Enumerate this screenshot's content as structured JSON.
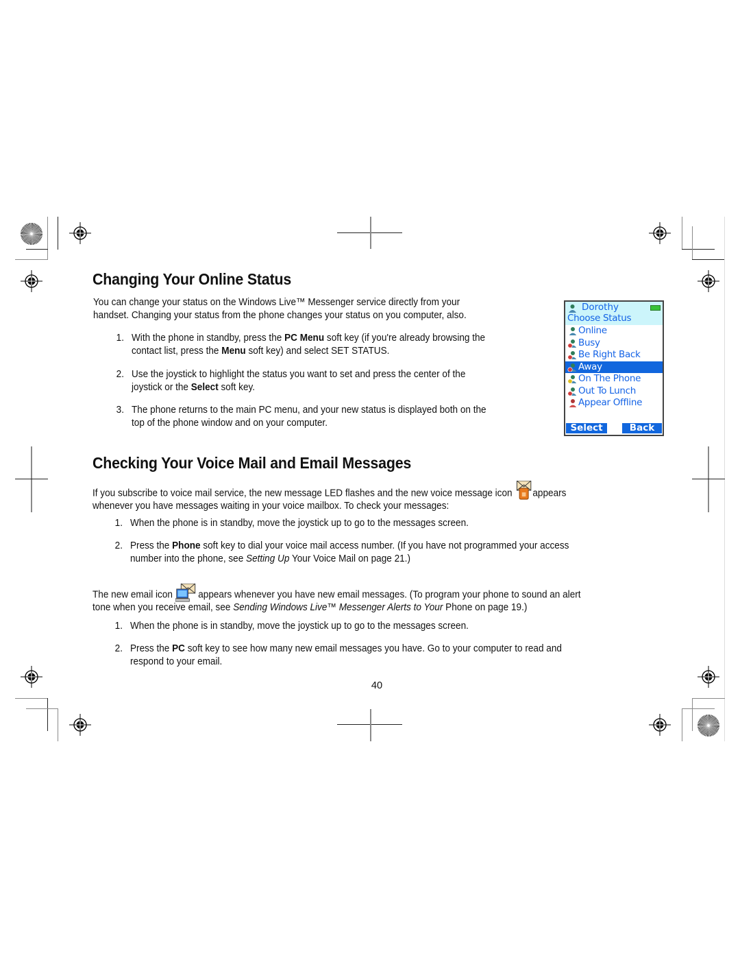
{
  "page_number": "40",
  "section1": {
    "heading": "Changing Your Online Status",
    "intro_line1": "You can change your status on the Windows Live™ Messenger service directly from your",
    "intro_line2": "handset. Changing your status from the phone changes your status on you computer, also.",
    "steps": [
      {
        "num": "1.",
        "line1_pre": "With the phone in standby, press the ",
        "line1_bold": "PC Menu",
        "line1_post": " soft key (if you're already browsing the",
        "line2_pre": "contact list, press the ",
        "line2_bold": "Menu",
        "line2_post": " soft key) and select SET STATUS."
      },
      {
        "num": "2.",
        "line1": "Use the joystick to highlight the status you want to set and press the center of the",
        "line2_pre": "joystick or the ",
        "line2_bold": "Select",
        "line2_post": " soft key."
      },
      {
        "num": "3.",
        "line1": "The phone returns to the main PC menu, and your new status is displayed both on the",
        "line2": "top of the phone window and on your computer."
      }
    ]
  },
  "phone_screen": {
    "user_name": "Dorothy",
    "title": "Choose Status",
    "battery_icon": "battery-full-icon",
    "statuses": [
      {
        "label": "Online",
        "icon": "user-online-icon",
        "selected": false
      },
      {
        "label": "Busy",
        "icon": "user-busy-icon",
        "selected": false
      },
      {
        "label": "Be Right Back",
        "icon": "user-brb-icon",
        "selected": false
      },
      {
        "label": "Away",
        "icon": "user-away-icon",
        "selected": true
      },
      {
        "label": "On The Phone",
        "icon": "user-phone-icon",
        "selected": false
      },
      {
        "label": "Out To Lunch",
        "icon": "user-lunch-icon",
        "selected": false
      },
      {
        "label": "Appear Offline",
        "icon": "user-offline-icon",
        "selected": false
      }
    ],
    "left_softkey": "Select",
    "right_softkey": "Back",
    "colors": {
      "header_bg": "#ccf5fb",
      "text": "#1463e6",
      "highlight": "#1166dd"
    }
  },
  "section2": {
    "heading": "Checking Your Voice Mail and Email Messages",
    "intro_line1_pre": "If you subscribe to voice mail service, the new message LED flashes and the new voice message icon ",
    "intro_line1_post": "appears",
    "intro_line2": "whenever you have messages waiting in your voice mailbox. To check your messages:",
    "voice_steps": [
      {
        "num": "1.",
        "line1": "When the phone is in standby, move the joystick up to go to the messages screen."
      },
      {
        "num": "2.",
        "line1_pre": "Press the ",
        "line1_bold": "Phone",
        "line1_post": " soft key to dial your voice mail access number. (If you have not programmed your access",
        "line2_pre": "number into the phone, see ",
        "line2_italic": "Setting Up",
        "line2_post": " Your Voice Mail on page 21.)"
      }
    ],
    "email_line1_pre": "The new email icon ",
    "email_line1_post": " appears whenever you have new email messages. (To program your phone to sound an alert",
    "email_line2_pre": "tone when you receive email, see ",
    "email_line2_italic": "Sending Windows Live™ Messenger Alerts to Your",
    "email_line2_post": " Phone on page 19.)",
    "email_steps": [
      {
        "num": "1.",
        "line1": "When the phone is in standby, move the joystick up to go to the messages screen."
      },
      {
        "num": "2.",
        "line1_pre": "Press the ",
        "line1_bold": "PC",
        "line1_post": " soft key to see how many new email messages you have. Go to your computer to read and",
        "line2": "respond to your email."
      }
    ]
  }
}
